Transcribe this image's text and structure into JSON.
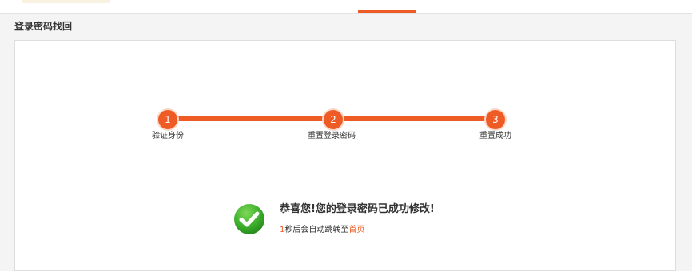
{
  "section": {
    "title": "登录密码找回"
  },
  "steps": [
    {
      "number": "1",
      "label": "验证身份"
    },
    {
      "number": "2",
      "label": "重置登录密码"
    },
    {
      "number": "3",
      "label": "重置成功"
    }
  ],
  "result": {
    "title": "恭喜您!您的登录密码已成功修改!",
    "countdown": "1",
    "redirect_text": "秒后会自动跳转至",
    "home_link": "首页"
  },
  "colors": {
    "accent": "#ee5a24",
    "success": "#3cae2c"
  }
}
